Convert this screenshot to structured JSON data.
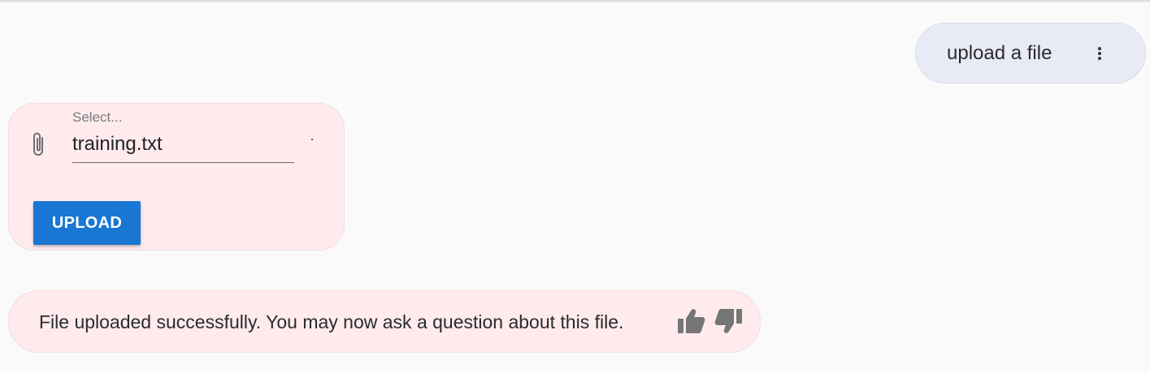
{
  "user_message": {
    "text": "upload a file",
    "menu_icon": "more-vert-icon"
  },
  "upload_form": {
    "attach_icon": "paperclip-icon",
    "select_label": "Select...",
    "selected_file": "training.txt",
    "upload_label": "UPLOAD"
  },
  "bot_message": {
    "text": "File uploaded successfully. You may now ask a question about this file.",
    "feedback_icons": [
      "thumbs-up-icon",
      "thumbs-down-icon"
    ]
  },
  "colors": {
    "background": "#fafafa",
    "user_bubble": "#e8eaf6",
    "bot_bubble": "#ffebee",
    "primary_button": "#1976d2",
    "icon_gray": "#757575"
  }
}
